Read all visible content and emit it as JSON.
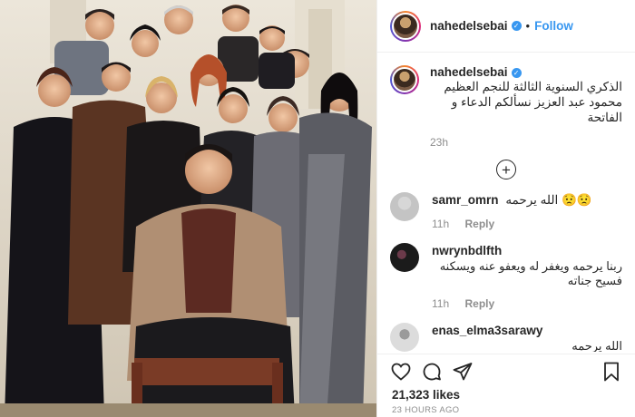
{
  "post": {
    "username": "nahedelsebai",
    "follow_label": "Follow",
    "separator": "•",
    "caption": "الذكري السنوية الثالثة للنجم العظيم محمود عبد العزيز نسألكم الدعاء و الفاتحة",
    "caption_time": "23h",
    "likes": "21,323 likes",
    "posted_ago": "23 HOURS AGO"
  },
  "comments": [
    {
      "user": "samr_omrn",
      "text": "الله يرحمه 😟😟",
      "time": "11h",
      "reply": "Reply"
    },
    {
      "user": "nwrynbdlfth",
      "text": "ربنا يرحمه ويغفر له ويعفو عنه ويسكنه فسيح جناته",
      "time": "11h",
      "reply": "Reply"
    },
    {
      "user": "enas_elma3sarawy",
      "text": "الله يرحمه"
    }
  ],
  "icons": {
    "like": "heart-icon",
    "comment": "comment-icon",
    "share": "share-icon",
    "save": "bookmark-icon",
    "load_more": "plus-circle-icon"
  },
  "colors": {
    "accent": "#3897f0",
    "text": "#262626",
    "muted": "#8e8e8e",
    "divider": "#efefef"
  }
}
